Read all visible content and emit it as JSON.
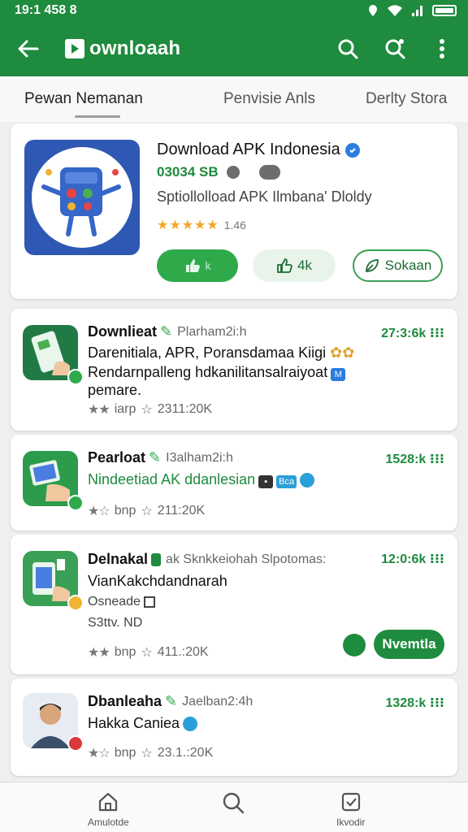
{
  "status_bar": {
    "time": "19:1 458 8"
  },
  "app_bar": {
    "title": "ownloaah"
  },
  "tabs": [
    "Pewan Nemanan",
    "Penvisie Anls",
    "Derlty Stora"
  ],
  "featured": {
    "title": "Download APK Indonesia",
    "meta": "03034 SB",
    "description": "Sptiollolload APK Ilmbana' Dloldy",
    "rating_text": "1.46",
    "count_label": "4k",
    "share_label": "Sokaan"
  },
  "items": [
    {
      "title": "Downlieat",
      "subtitle": "Plarham2i:h",
      "time": "27:3:6k",
      "lines": [
        "Darenitiala, APR, Poransdamaa Kiigi",
        "Rendarnpalleng hdkanilitansalraiyoat",
        "pemare."
      ],
      "rating": "2311:20K",
      "rating_prefix": "iarp"
    },
    {
      "title": "Pearloat",
      "subtitle": "I3alham2i:h",
      "time": "1528:k",
      "lines": [
        "Nindeetiad AK ddanlesian"
      ],
      "badge": "Bca",
      "rating": "211:20K",
      "rating_prefix": "bnp"
    },
    {
      "title": "Delnakal",
      "subtitle": "ak Sknkkeiohah Slpotomas:",
      "time": "12:0:6k",
      "lines": [
        "VianKakchdandnarah",
        "Osneade",
        "S3ttv. ND"
      ],
      "rating": "411.:20K",
      "rating_prefix": "bnp",
      "action_label": "Nvemtla"
    },
    {
      "title": "Dbanleaha",
      "subtitle": "Jaelban2:4h",
      "time": "1328:k",
      "lines": [
        "Hakka Caniea"
      ],
      "rating": "23.1.:20K",
      "rating_prefix": "bnp"
    }
  ],
  "bottom_nav": [
    "Amulotde",
    "",
    "Ikvodir"
  ],
  "colors": {
    "primary": "#1e8b3e",
    "accent": "#2eaa4b",
    "star": "#f5a623",
    "verified": "#2b7de0"
  }
}
